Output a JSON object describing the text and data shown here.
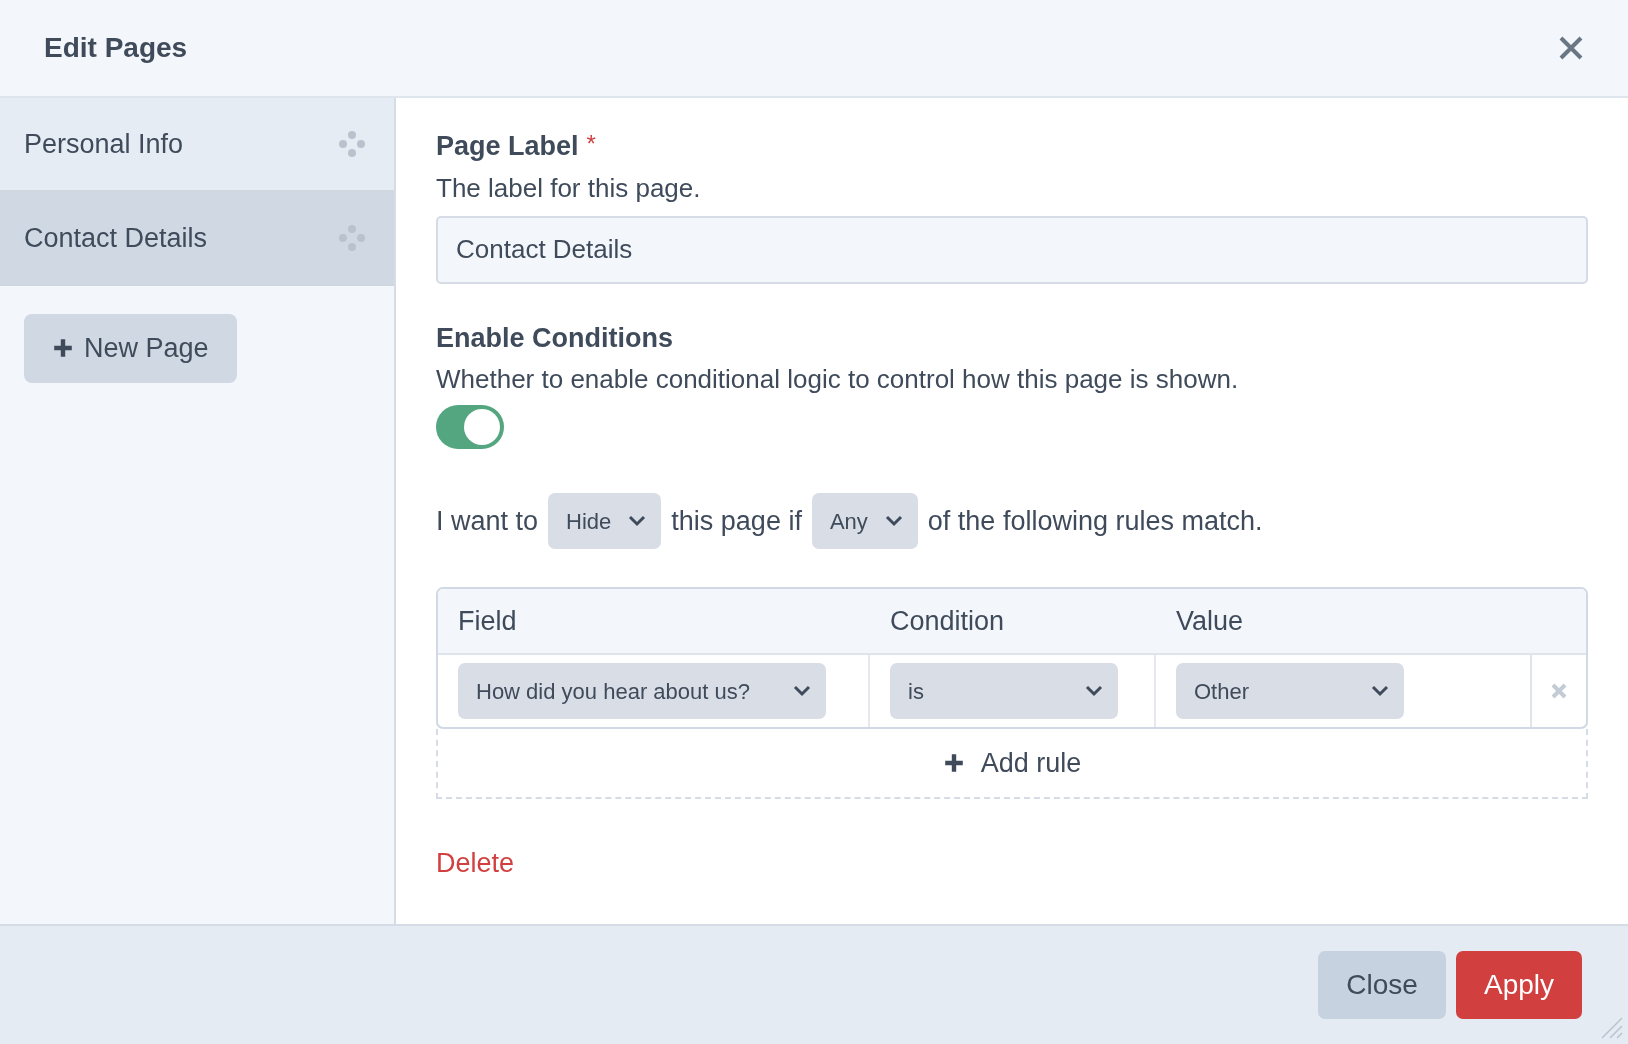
{
  "dialog": {
    "title": "Edit Pages"
  },
  "sidebar": {
    "items": [
      {
        "label": "Personal Info",
        "selected": false
      },
      {
        "label": "Contact Details",
        "selected": true
      }
    ],
    "new_button": "New Page"
  },
  "page_label": {
    "label": "Page Label",
    "required_mark": "*",
    "hint": "The label for this page.",
    "value": "Contact Details"
  },
  "enable_conditions": {
    "label": "Enable Conditions",
    "hint": "Whether to enable conditional logic to control how this page is shown.",
    "on": true
  },
  "rule_sentence": [
    {
      "kind": "text",
      "text": "I want to"
    },
    {
      "kind": "select",
      "text": "Hide"
    },
    {
      "kind": "text",
      "text": "this page if"
    },
    {
      "kind": "select",
      "text": "Any"
    },
    {
      "kind": "text",
      "text": "of the following rules match."
    }
  ],
  "rules_table": {
    "columns": [
      "Field",
      "Condition",
      "Value"
    ],
    "rows": [
      {
        "field": "How did you hear about us?",
        "condition": "is",
        "value": "Other"
      }
    ],
    "add_button": "Add rule"
  },
  "delete_link": "Delete",
  "footer": {
    "buttons": [
      {
        "label": "Close",
        "kind": "secondary"
      },
      {
        "label": "Apply",
        "kind": "primary"
      }
    ]
  }
}
